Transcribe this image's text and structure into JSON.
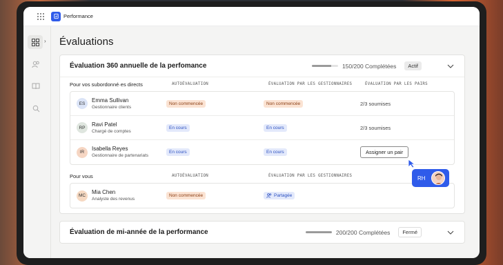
{
  "app": {
    "name": "Performance"
  },
  "page": {
    "title": "Évaluations"
  },
  "colors": {
    "accent": "#2f5bea",
    "orange_pill": "#fbe3d3",
    "blue_pill": "#e3e9fb"
  },
  "sidebar": {
    "icons": [
      "dashboard-icon",
      "people-icon",
      "book-icon",
      "search-icon"
    ]
  },
  "review_annual": {
    "title": "Évaluation 360 annuelle de la perfomance",
    "progress_text": "150/200 Complétées",
    "progress_fraction": 0.75,
    "status": "Actif",
    "section_reports": {
      "label": "Pour vos subordonné·es directs",
      "col_self": "AUTOÉVALUATION",
      "col_managers": "ÉVALUATION PAR LES GESTIONNAIRES",
      "col_peers": "ÉVALUATION PAR LES PAIRS",
      "rows": [
        {
          "initials": "ES",
          "name": "Emma Sullivan",
          "role": "Gestionnaire clients",
          "self": "Non commencée",
          "managers": "Non commencée",
          "peers": "2/3 soumises",
          "avatar_color": "#dbe4f7"
        },
        {
          "initials": "RP",
          "name": "Ravi Patel",
          "role": "Chargé de comptes",
          "self": "En cours",
          "managers": "En cours",
          "peers": "2/3 soumises",
          "avatar_color": "#dfe6df"
        },
        {
          "initials": "IR",
          "name": "Isabella Reyes",
          "role": "Gestionnaire de partenariats",
          "self": "En cours",
          "managers": "En cours",
          "peers_button": "Assigner un pair",
          "avatar_color": "#f6d6c3"
        }
      ]
    },
    "section_you": {
      "label": "Pour vous",
      "col_self": "AUTOÉVALUATION",
      "col_managers": "ÉVALUATION PAR LES GESTIONNAIRES",
      "row": {
        "initials": "MC",
        "name": "Mia Chen",
        "role": "Analyste des revenus",
        "self": "Non commencée",
        "managers": "Partagée",
        "avatar_color": "#f6d9c2"
      }
    }
  },
  "review_mid": {
    "title": "Évaluation de mi-année de la performance",
    "progress_text": "200/200 Complétées",
    "progress_fraction": 1.0,
    "status": "Fermé"
  },
  "collaborator": {
    "initials": "RH"
  }
}
